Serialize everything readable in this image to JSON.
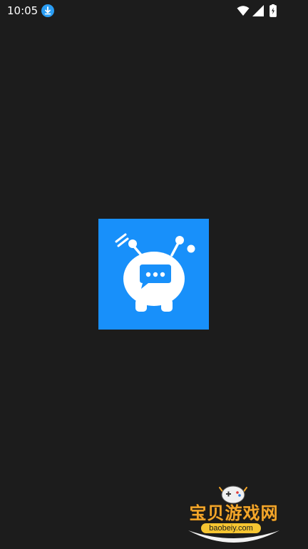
{
  "status_bar": {
    "time": "10:05",
    "icons": [
      "download-icon",
      "wifi-icon",
      "signal-icon",
      "battery-icon"
    ]
  },
  "app_icon": {
    "icon": "robot-chat-icon",
    "background_color": "#1890fa",
    "foreground_color": "#ffffff"
  },
  "watermark": {
    "title": "宝贝游戏网",
    "domain": "baobeiy.com",
    "title_color": "#f4a62a",
    "domain_bg_color": "#f6c531"
  }
}
